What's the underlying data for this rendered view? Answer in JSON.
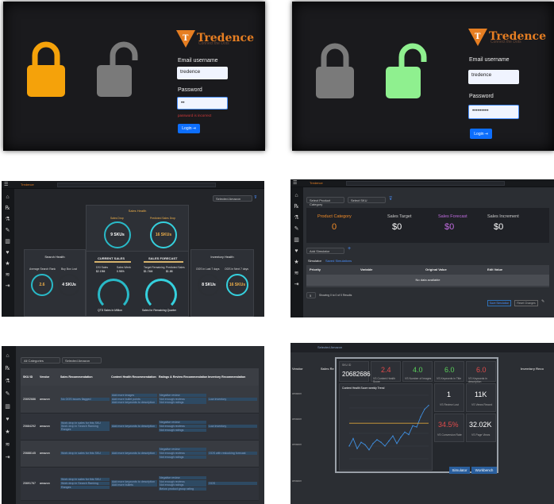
{
  "login_common": {
    "brand_name": "Tredence",
    "tagline": "Connect the Dots",
    "email_label": "Email username",
    "password_label": "Password",
    "login_label": "Login"
  },
  "login_fail": {
    "email_value": "tredence",
    "password_value": "••",
    "error": "password is incorrect"
  },
  "login_success": {
    "email_value": "tredence",
    "password_value": "•••••••••"
  },
  "dashboard": {
    "brand": "Tredence",
    "dropdown": "Selected Amazon",
    "sales_health": "Sales Health",
    "search_health": "Search Health",
    "inventory_health": "Inventory Health",
    "current_sales": "CURRENT SALES",
    "sales_forecast": "SALES FORECAST",
    "sales_drop": "Sales Drop",
    "sales_drop_val": "9 SKUs",
    "predicted_drop": "Predicted Sales Drop",
    "predicted_drop_val": "16 SKUs",
    "avg_search": "Average Search Rank",
    "avg_search_val": "2.6",
    "buy_box": "Buy Box Lost",
    "buy_box_val": "4 SKUs",
    "oos_last": "OOS in Last 7 days",
    "oos_last_val": "8 SKUs",
    "oos_next": "OOS in Next 7 days",
    "oos_next_val": "16 SKUs",
    "qtd_sales": "QTD Sales In Million",
    "remaining": "Sales for Remaining Quarter",
    "kpi1_label": "DSI Sales",
    "kpi1_val": "$2.19M",
    "kpi2_label": "Sales Week",
    "kpi2_val": "0.96%",
    "kpi3_label": "Target Remaining",
    "kpi3_val": "$1.74M",
    "kpi4_label": "Predicted Sales",
    "kpi4_val": "$1.88"
  },
  "simulator": {
    "category_select": "Select Product Category",
    "sku_select": "Select SKU",
    "product_category": "Product Category",
    "product_category_val": "0",
    "sales_target": "Sales Target",
    "sales_target_val": "$0",
    "sales_forecast": "Sales Forecast",
    "sales_forecast_val": "$0",
    "sales_increment": "Sales Increment",
    "sales_increment_val": "$0",
    "add_simulator": "Add Simulator",
    "tabs": [
      "Simulator",
      "Saved Simulations"
    ],
    "columns": [
      "Priority",
      "Variable",
      "Original Value",
      "Edit Value"
    ],
    "no_data": "No data available",
    "rows_per_page": "5",
    "showing": "Showing 0 to 0 of 0 Results",
    "save_btn": "Save Simulation",
    "reset_btn": "Reset Changes"
  },
  "recommend": {
    "category": "All Categories",
    "selected": "Selected Amazon",
    "headers": [
      "SKU ID",
      "Vendor",
      "Sales Recommendation",
      "Content Health Recommendation",
      "Ratings & Review Recommendation",
      "Inventory Recommendation"
    ],
    "rows": [
      {
        "id": "20692686",
        "vendor": "amazon",
        "sales": [
          "No OOS issues flagged"
        ],
        "content": [
          "Add more images",
          "Add more bullet points",
          "Add more keywords to description"
        ],
        "ratings": [
          "Negative review",
          "Not enough reviews",
          "Not enough ratings"
        ],
        "inventory": [
          "Low inventory"
        ]
      },
      {
        "id": "20684292",
        "vendor": "amazon",
        "sales": [
          "Work drop in sales for this SKU",
          "Work drop in Search Ranking Ranges"
        ],
        "content": [
          "Add more keywords to description"
        ],
        "ratings": [
          "Negative review",
          "Not enough reviews",
          "Not enough ratings"
        ],
        "inventory": [
          "Low inventory"
        ]
      },
      {
        "id": "20688145",
        "vendor": "amazon",
        "sales": [
          "Work drop in sales for this SKU"
        ],
        "content": [
          "Add more keywords to description"
        ],
        "ratings": [
          "Negative review",
          "Not enough reviews",
          "Not enough ratings"
        ],
        "inventory": [
          "OOS with restocking forecast"
        ]
      },
      {
        "id": "20691767",
        "vendor": "amazon",
        "sales": [
          "Work drop in sales for this SKU",
          "Work drop in Search Ranking",
          "Ranges"
        ],
        "content": [
          "Add more keywords to description",
          "Add more bullets"
        ],
        "ratings": [
          "Negative review",
          "Not enough reviews",
          "Not enough ratings",
          "Below product group rating"
        ],
        "inventory": [
          "OOS"
        ]
      }
    ]
  },
  "detail": {
    "selected": "Selected Amazon",
    "vendor_col": "Vendor",
    "sales_col": "Sales Re",
    "inv_col": "Inventory Reco",
    "sku_label": "SKU ID",
    "sku_val": "20682686",
    "m1_val": "2.4",
    "m1_label": "VS Content Health Score",
    "m2_val": "4.0",
    "m2_label": "VS Number of Images",
    "m3_val": "6.0",
    "m3_label": "VS Keywords in Title",
    "m4_val": "6.0",
    "m4_label": "VS Keywords in description",
    "chart_title": "Content Health Score weekly Trend",
    "m5_val": "1",
    "m5_label": "VS Review Lost",
    "m6_val": "11K",
    "m6_label": "VS Views Record",
    "m7_val": "34.5%",
    "m7_label": "VS Conversion Rate",
    "m8_val": "32.02K",
    "m8_label": "VS Page Views",
    "simulator_btn": "Simulator",
    "workbench_btn": "Workbench",
    "vendor_rows": [
      "amazon",
      "amazon",
      "amazon",
      "amazon"
    ]
  },
  "chart_data": {
    "type": "line",
    "title": "Content Health Score weekly Trend",
    "series": [
      {
        "values": [
          1.0,
          1.6,
          0.8,
          1.3,
          1.1,
          0.7,
          1.2,
          1.5,
          1.3,
          1.0,
          1.4,
          1.8,
          1.2,
          1.7,
          2.1,
          1.9,
          2.6,
          2.5,
          3.3,
          3.9,
          4.2
        ]
      },
      {
        "values": [
          2.8,
          2.8,
          2.8,
          2.8,
          2.8,
          2.8,
          2.8,
          2.8,
          2.8,
          2.8,
          2.8,
          2.8,
          2.8,
          2.8,
          2.8,
          2.8,
          2.8,
          2.8,
          2.8,
          2.8,
          2.8
        ]
      }
    ],
    "ylim": [
      0,
      5
    ]
  },
  "colors": {
    "orange": "#f5a20a",
    "green": "#8ff08f",
    "gray": "#777777",
    "accent_blue": "#0d6efd",
    "teal": "#29b9c7"
  }
}
